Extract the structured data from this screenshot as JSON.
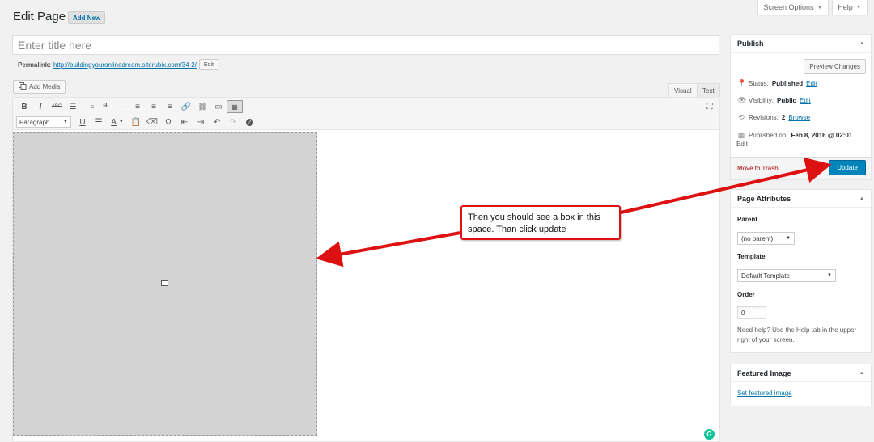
{
  "header": {
    "screen_options": "Screen Options",
    "help": "Help",
    "page_title": "Edit Page",
    "add_new": "Add New"
  },
  "editor": {
    "title_placeholder": "Enter title here",
    "permalink_label": "Permalink:",
    "permalink_url": "http://buildingyouronlinedream.siterubix.com/34-2/",
    "permalink_edit": "Edit",
    "add_media": "Add Media",
    "tab_visual": "Visual",
    "tab_text": "Text",
    "format_select": "Paragraph",
    "toolbar_row1": [
      "bold-icon",
      "italic-icon",
      "strikethrough-icon",
      "bullet-list-icon",
      "numbered-list-icon",
      "blockquote-icon",
      "horizontal-rule-icon",
      "align-left-icon",
      "align-center-icon",
      "align-right-icon",
      "link-icon",
      "unlink-icon",
      "read-more-icon",
      "toolbar-toggle-icon"
    ],
    "toolbar_row2": [
      "underline-icon",
      "justify-icon",
      "text-color-icon",
      "paste-text-icon",
      "clear-formatting-icon",
      "special-character-icon",
      "outdent-icon",
      "indent-icon",
      "undo-icon",
      "redo-icon",
      "help-icon"
    ]
  },
  "publish": {
    "title": "Publish",
    "preview_button": "Preview Changes",
    "status_label": "Status:",
    "status_value": "Published",
    "status_edit": "Edit",
    "visibility_label": "Visibility:",
    "visibility_value": "Public",
    "visibility_edit": "Edit",
    "revisions_label": "Revisions:",
    "revisions_value": "2",
    "revisions_browse": "Browse",
    "published_label": "Published on:",
    "published_value": "Feb 8, 2016 @ 02:01",
    "published_edit": "Edit",
    "trash": "Move to Trash",
    "update": "Update"
  },
  "page_attributes": {
    "title": "Page Attributes",
    "parent_label": "Parent",
    "parent_value": "(no parent)",
    "template_label": "Template",
    "template_value": "Default Template",
    "order_label": "Order",
    "order_value": "0",
    "help_text": "Need help? Use the Help tab in the upper right of your screen."
  },
  "featured_image": {
    "title": "Featured Image",
    "link": "Set featured image"
  },
  "annotation": {
    "text": "Then you should see a box in this space. Than click update",
    "color": "#dd1111"
  },
  "colors": {
    "primary_button": "#0085ba",
    "link": "#0073aa",
    "trash": "#aa0000"
  }
}
